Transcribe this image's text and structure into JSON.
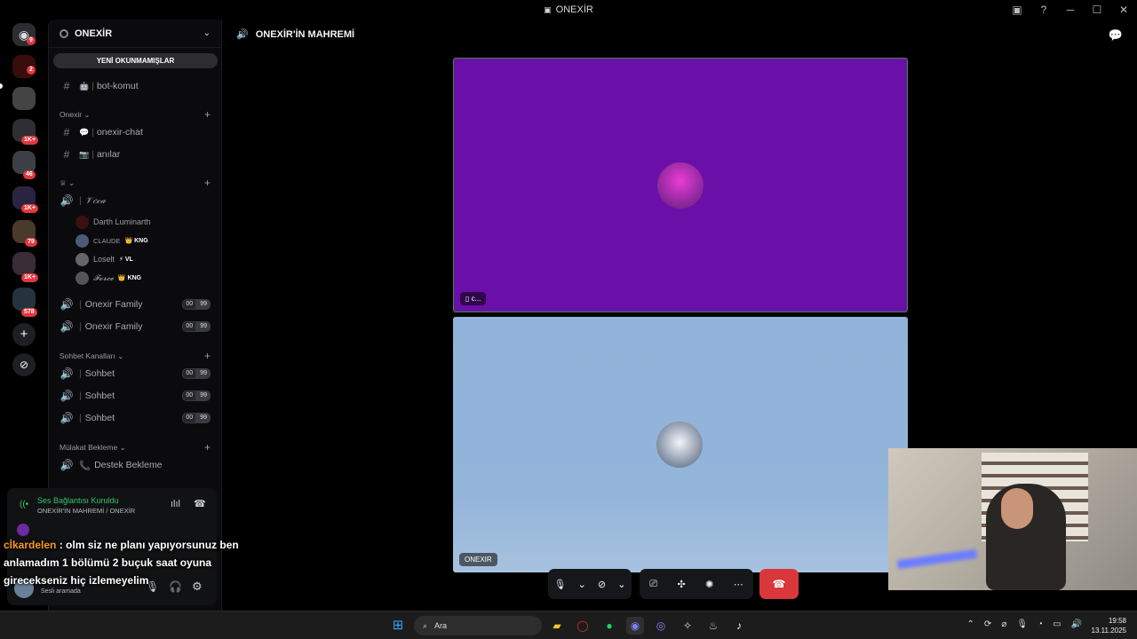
{
  "window": {
    "title": "ONEXİR"
  },
  "rail": {
    "badges": [
      "9",
      "2",
      "1K+",
      "46",
      "1K+",
      "79",
      "1K+",
      "578"
    ]
  },
  "sidebar": {
    "guild_name": "ONEXİR",
    "unread_label": "YENİ OKUNMAMIŞLAR",
    "channels_top": [
      {
        "icon": "🤖",
        "name": "bot-komut"
      }
    ],
    "cat1": "Onexir",
    "channels_cat1": [
      {
        "icon": "💬",
        "name": "onexir-chat"
      },
      {
        "icon": "📷",
        "name": "anılar"
      }
    ],
    "cat2": "",
    "voice1": "𝒱𝑒𝒸𝒶",
    "members": [
      {
        "name": "Darth Luminarth",
        "tag": ""
      },
      {
        "name": "CLAUDE",
        "tag": "👑 KNG"
      },
      {
        "name": "Loselt",
        "tag": "⚡ VL"
      },
      {
        "name": "𝓕𝓸𝓻𝓬𝓮",
        "tag": "👑 KNG"
      }
    ],
    "family": [
      "Onexir Family",
      "Onexir Family"
    ],
    "count_left": "00",
    "count_right": "99",
    "cat3": "Sohbet Kanalları",
    "sohbet": [
      "Sohbet",
      "Sohbet",
      "Sohbet"
    ],
    "cat4": "Mülakat Bekleme",
    "destek": "Destek Bekleme"
  },
  "voice_panel": {
    "status": "Ses Bağlantısı Kuruldu",
    "location": "ONEXİR'İN MAHREMİ / ONEXİR",
    "user_status": "Sesli aramada"
  },
  "main": {
    "channel_title": "ONEXİR'İN MAHREMİ",
    "tile_top_label": "c...",
    "tile_bottom_label": "ONEXIR"
  },
  "overlay_chat": {
    "nick": "cİkardelen",
    "message": ": olm siz ne planı yapıyorsunuz ben anlamadım 1 bölümü 2 buçuk saat oyuna girecekseniz hiç izlemeyelim"
  },
  "taskbar": {
    "search_placeholder": "Ara",
    "time": "19:58",
    "date": "13.11.2025"
  },
  "colors": {
    "accent_top_tile": "#6a10a8",
    "hangup": "#da373c",
    "connected": "#35c46a"
  }
}
